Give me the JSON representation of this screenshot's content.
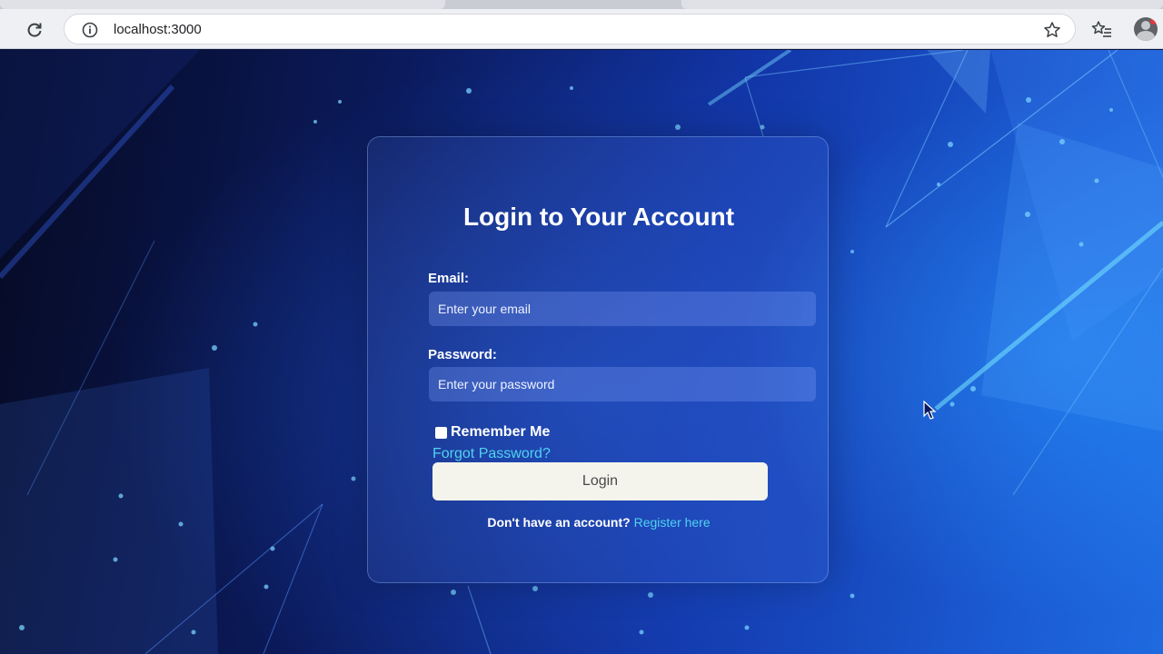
{
  "browser": {
    "url": "localhost:3000",
    "icons": {
      "reload": "reload-icon",
      "site_info": "info-icon",
      "bookmark": "star-icon",
      "favorites": "favorites-icon",
      "profile": "profile-icon"
    }
  },
  "login": {
    "title": "Login to Your Account",
    "email_label": "Email:",
    "email_placeholder": "Enter your email",
    "email_value": "",
    "password_label": "Password:",
    "password_placeholder": "Enter your password",
    "password_value": "",
    "remember_me_label": "Remember Me",
    "remember_me_checked": false,
    "forgot_password_link": "Forgot Password?",
    "login_button": "Login",
    "register_prompt": "Don't have an account?",
    "register_link": "Register here"
  },
  "colors": {
    "link": "#4fd3f0",
    "button_bg": "#f4f4ec",
    "text": "#ffffff",
    "background_deep": "#0b1a5c",
    "background_bright": "#1f6ae0"
  }
}
